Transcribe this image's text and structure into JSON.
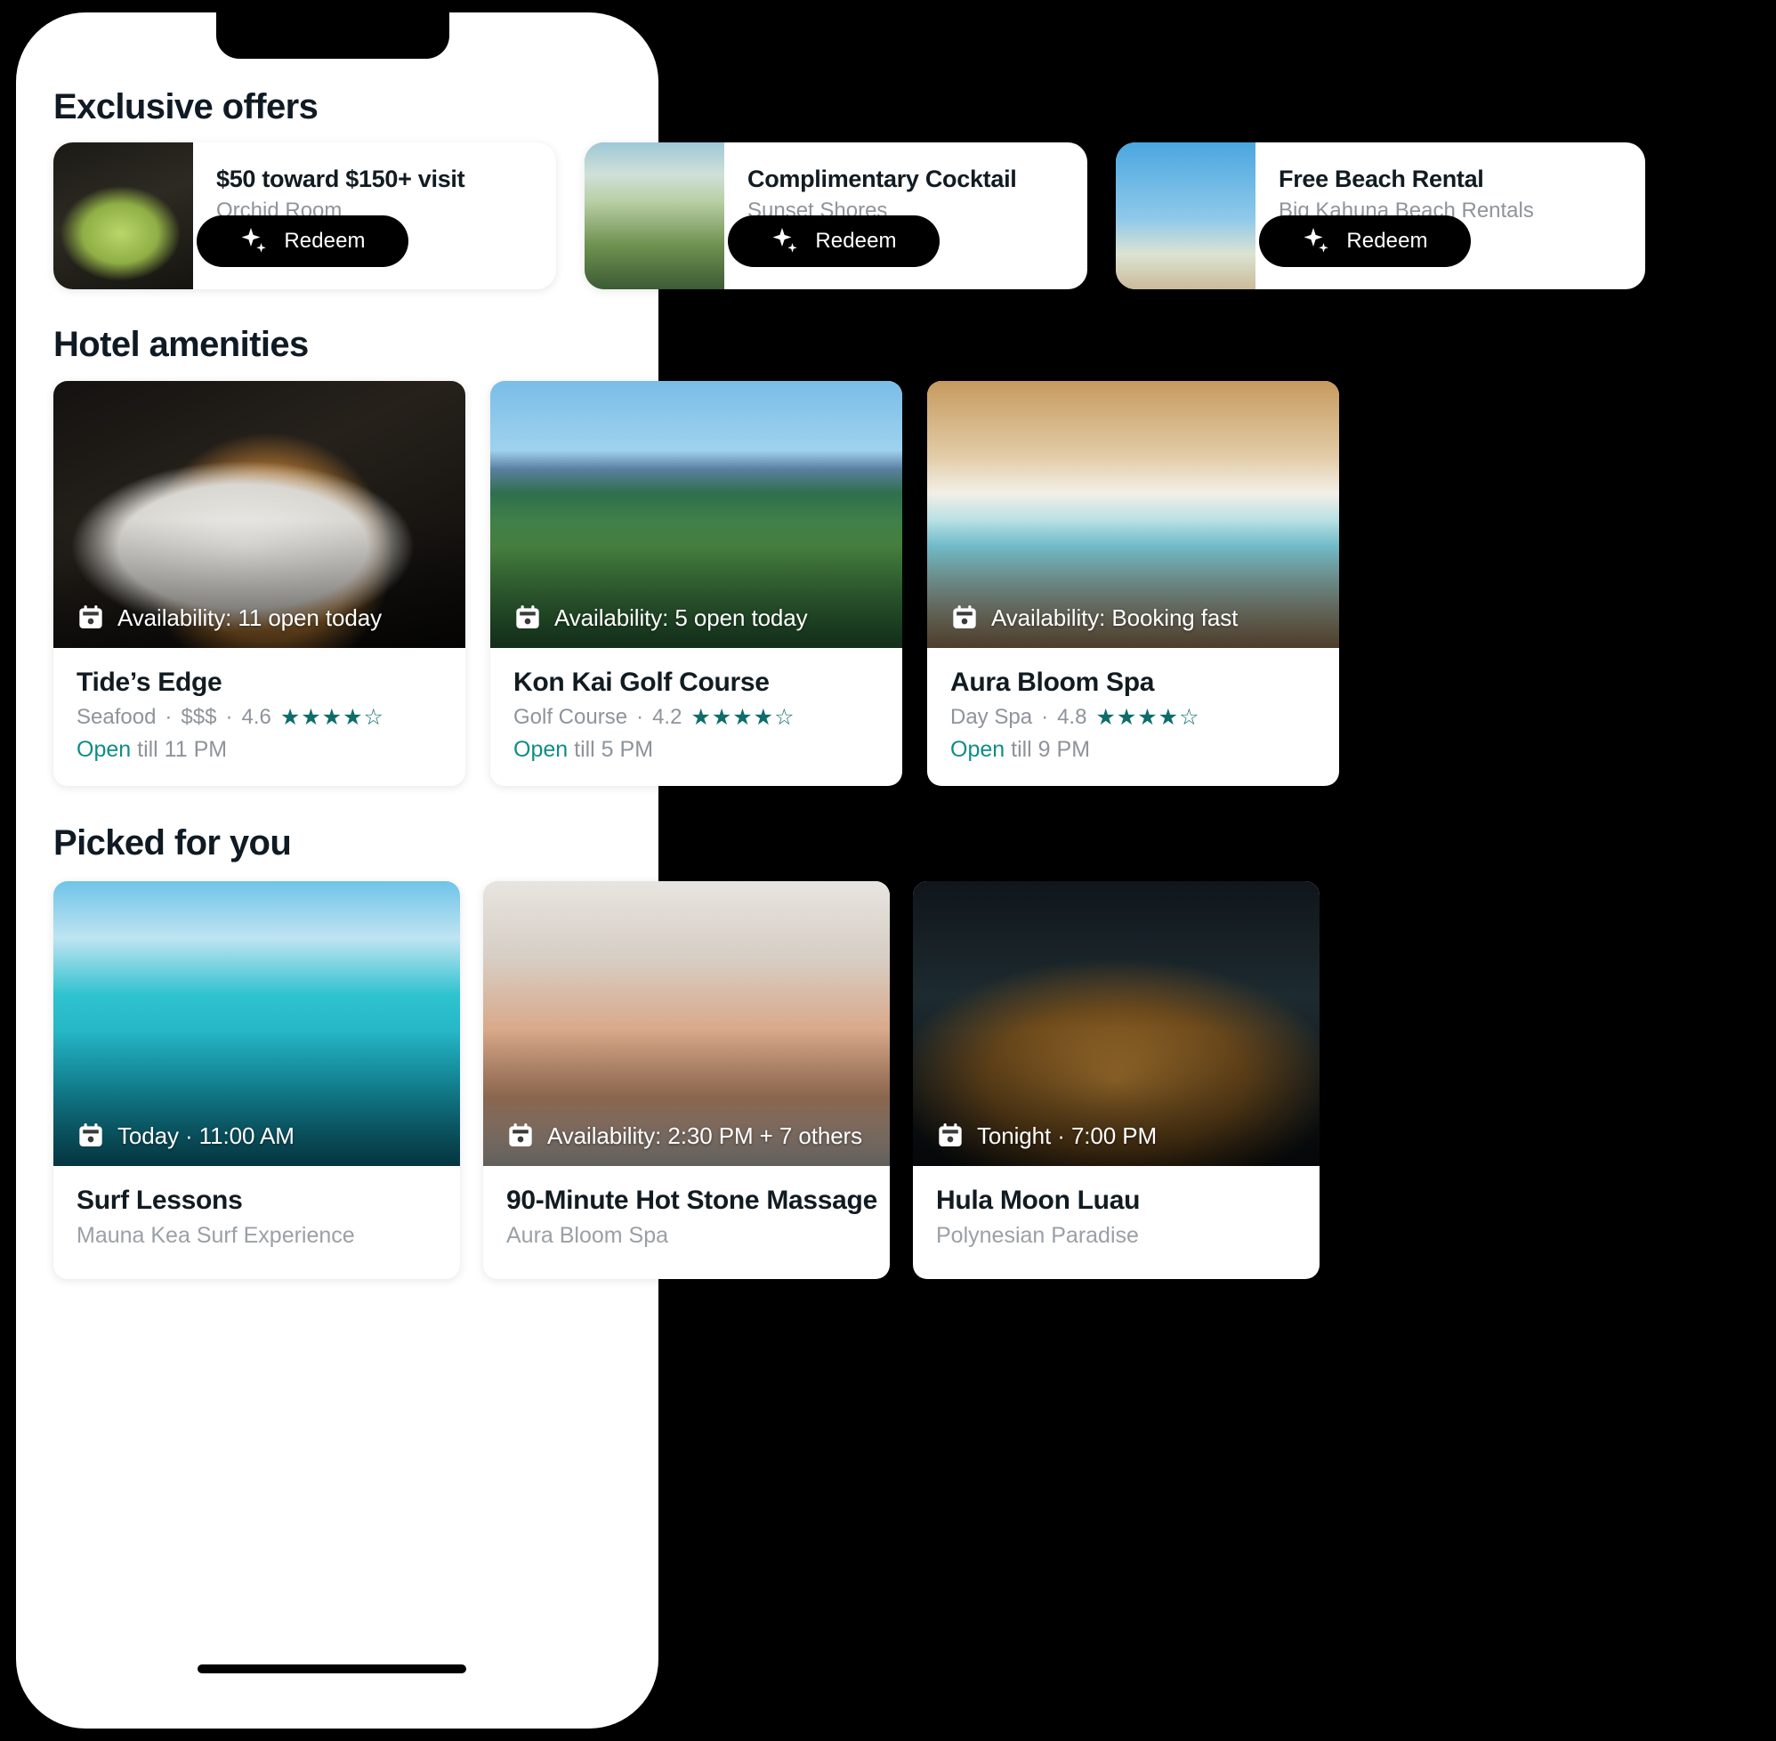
{
  "device": {
    "notch": "phone-notch",
    "home_indicator": "home-indicator"
  },
  "sections": [
    {
      "id": "exclusive-offers",
      "title": "Exclusive offers"
    },
    {
      "id": "hotel-amenities",
      "title": "Hotel amenities"
    },
    {
      "id": "picked-for-you",
      "title": "Picked for you"
    }
  ],
  "colors": {
    "background": "#000000",
    "card_surface": "#ffffff",
    "heading": "#0f1a24",
    "muted_text": "#8e949a",
    "accent_teal": "#0e8d86",
    "star_teal": "#0e6d6b",
    "button": "#000000",
    "button_label": "#ffffff"
  },
  "offers": {
    "title": "Exclusive offers",
    "items": [
      {
        "title": "$50 toward $150+ visit",
        "venue": "Orchid Room",
        "button_label": "Redeem",
        "icon": "sparkle-icon",
        "image": "img-duck"
      },
      {
        "title": "Complimentary Cocktail",
        "venue": "Sunset Shores",
        "button_label": "Redeem",
        "icon": "sparkle-icon",
        "image": "img-cocktail"
      },
      {
        "title": "Free Beach Rental",
        "venue": "Big Kahuna Beach Rentals",
        "button_label": "Redeem",
        "icon": "sparkle-icon",
        "image": "img-surfboards"
      }
    ]
  },
  "amenities": {
    "title": "Hotel amenities",
    "items": [
      {
        "availability": "Availability: 11 open today",
        "name": "Tide’s Edge",
        "category": "Seafood",
        "price": "$$$",
        "rating": "4.6",
        "stars": "★★★★☆",
        "open_word": "Open",
        "open_rest": " till 11 PM",
        "image": "img-plating"
      },
      {
        "availability": "Availability: 5 open today",
        "name": "Kon Kai Golf Course",
        "category": "Golf Course",
        "price": "",
        "rating": "4.2",
        "stars": "★★★★☆",
        "open_word": "Open",
        "open_rest": " till 5 PM",
        "image": "img-golf"
      },
      {
        "availability": "Availability: Booking fast",
        "name": "Aura Bloom Spa",
        "category": "Day Spa",
        "price": "",
        "rating": "4.8",
        "stars": "★★★★☆",
        "open_word": "Open",
        "open_rest": " till 9 PM",
        "image": "img-spa"
      }
    ]
  },
  "picked": {
    "title": "Picked for you",
    "items": [
      {
        "availability": "Today · 11:00 AM",
        "name": "Surf Lessons",
        "venue": "Mauna Kea Surf Experience",
        "image": "img-surf"
      },
      {
        "availability": "Availability: 2:30 PM + 7 others",
        "name": "90-Minute Hot Stone Massage",
        "venue": "Aura Bloom Spa",
        "image": "img-massage"
      },
      {
        "availability": "Tonight · 7:00 PM",
        "name": "Hula Moon Luau",
        "venue": "Polynesian Paradise",
        "image": "img-luau"
      }
    ]
  }
}
